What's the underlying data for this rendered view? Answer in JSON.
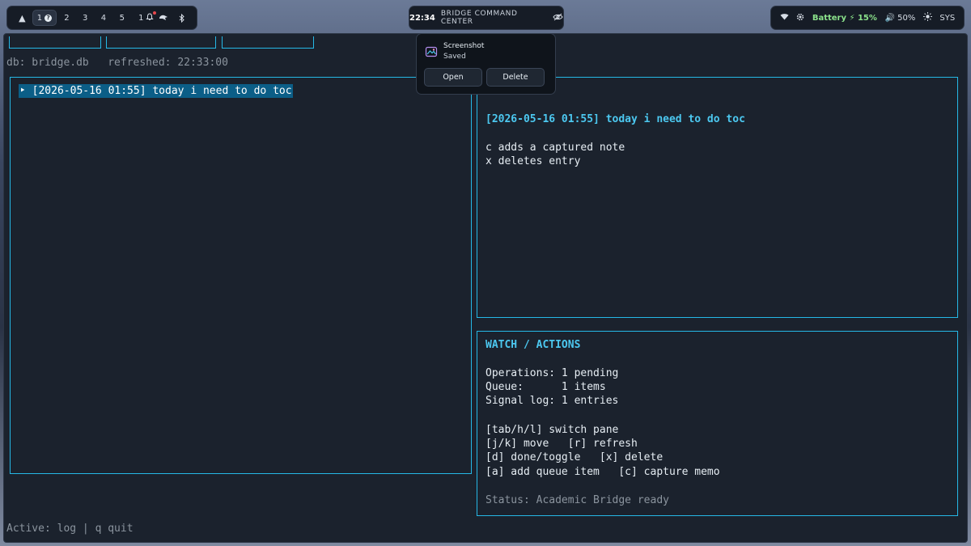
{
  "topbar": {
    "workspaces": [
      "1",
      "2",
      "3",
      "4",
      "5"
    ],
    "active_workspace": "1",
    "notification_count": "1",
    "clock": "22:34",
    "center_title": "BRIDGE COMMAND CENTER",
    "battery_label": "Battery ⚡ 15%",
    "volume_label": "🔊 50%",
    "sys_label": "SYS",
    "icons": [
      "arch-icon",
      "question-icon",
      "bell-icon",
      "ghost-icon",
      "bluetooth-icon",
      "eye-off-icon",
      "wifi-icon",
      "gear-icon",
      "brightness-icon"
    ]
  },
  "terminal": {
    "info_line": "db: bridge.db   refreshed: 22:33:00",
    "log_entry": "‣ [2026-05-16 01:55] today i need to do toc",
    "detail": {
      "heading": "[2026-05-16 01:55] today i need to do toc",
      "lines": [
        "c adds a captured note",
        "x deletes entry"
      ]
    },
    "watch": {
      "title": "WATCH / ACTIONS",
      "stats": [
        "Operations: 1 pending",
        "Queue:      1 items",
        "Signal log: 1 entries"
      ],
      "keys": [
        "[tab/h/l] switch pane",
        "[j/k] move   [r] refresh",
        "[d] done/toggle   [x] delete",
        "[a] add queue item   [c] capture memo"
      ],
      "status": "Status: Academic Bridge ready"
    },
    "footer": "Active: log | q quit"
  },
  "notification": {
    "title": "Screenshot",
    "body": "Saved",
    "open_label": "Open",
    "delete_label": "Delete"
  },
  "colors": {
    "accent": "#25b8e6",
    "heading": "#4cc8f0",
    "selection": "#0b5e87",
    "battery": "#8be28b"
  }
}
